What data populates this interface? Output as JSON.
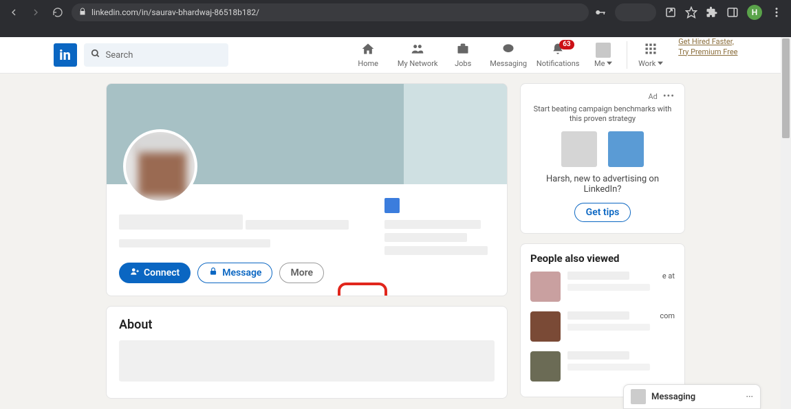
{
  "browser": {
    "url": "linkedin.com/in/saurav-bhardwaj-86518b182/",
    "avatar_letter": "H"
  },
  "nav": {
    "logo": "in",
    "search_placeholder": "Search",
    "items": {
      "home": "Home",
      "network": "My Network",
      "jobs": "Jobs",
      "messaging": "Messaging",
      "notifications": "Notifications",
      "me": "Me",
      "work": "Work"
    },
    "notif_badge": "63",
    "promo_line1": "Get Hired Faster,",
    "promo_line2": "Try Premium Free"
  },
  "profile": {
    "connect": "Connect",
    "message": "Message",
    "more": "More"
  },
  "about": {
    "heading": "About"
  },
  "ad": {
    "label": "Ad",
    "subtitle": "Start beating campaign benchmarks with this proven strategy",
    "question": "Harsh, new to advertising on LinkedIn?",
    "cta": "Get tips"
  },
  "pav": {
    "heading": "People also viewed",
    "hint1": "e at",
    "hint2": "com"
  },
  "messaging_dock": {
    "label": "Messaging",
    "icon1": "···"
  }
}
